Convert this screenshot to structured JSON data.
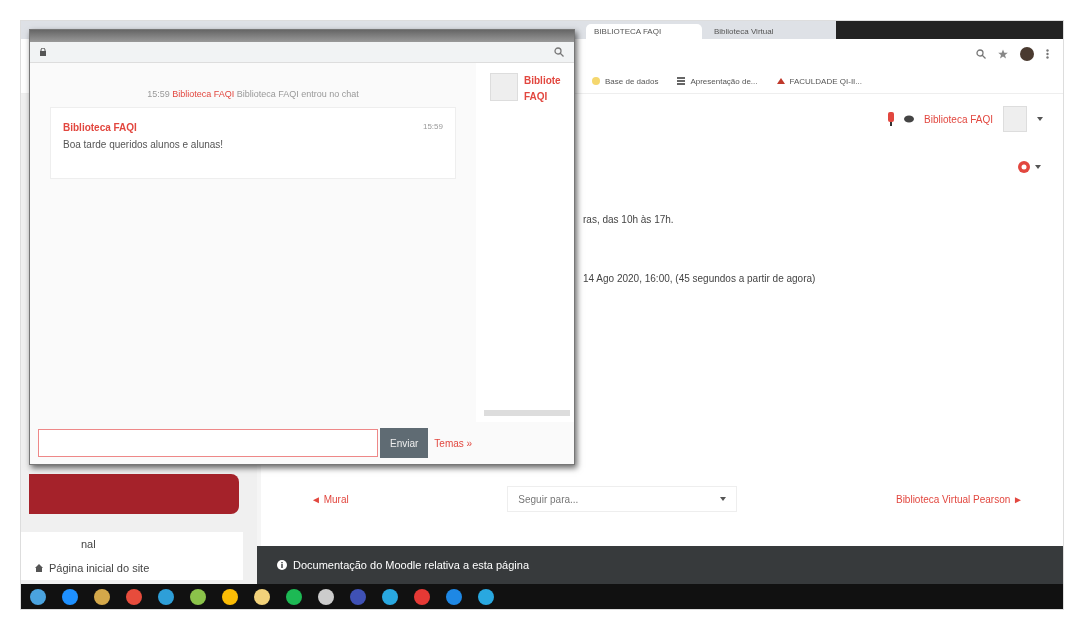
{
  "browser": {
    "tabs": [
      {
        "label": "BIBLIOTECA FAQI",
        "selected": true
      },
      {
        "label": "Biblioteca Virtual",
        "selected": false
      }
    ],
    "bookmarks": [
      "Base de dados",
      "Apresentação de...",
      "FACULDADE QI-II..."
    ]
  },
  "user_menu": {
    "name": "Biblioteca FAQI"
  },
  "sidebar": {
    "items": [
      "nal",
      "Página inicial do site"
    ]
  },
  "page": {
    "lines": [
      "ras, das 10h às 17h.",
      "14 Ago 2020, 16:00, (45 segundos a partir de agora)"
    ],
    "nav": {
      "previous": "◄ Mural",
      "jump_placeholder": "Seguir para...",
      "next": "Biblioteca Virtual Pearson ►"
    },
    "footer": "Documentação do Moodle relativa a esta página"
  },
  "chat": {
    "system_message": {
      "time": "15:59",
      "user": "Biblioteca FAQI",
      "text": "Biblioteca FAQI entrou no chat"
    },
    "messages": [
      {
        "user": "Biblioteca FAQI",
        "time": "15:59",
        "text": "Boa tarde queridos alunos e alunas!"
      }
    ],
    "users": [
      {
        "name": "Bibliote FAQI"
      }
    ],
    "send": "Enviar",
    "themes": "Temas »"
  }
}
